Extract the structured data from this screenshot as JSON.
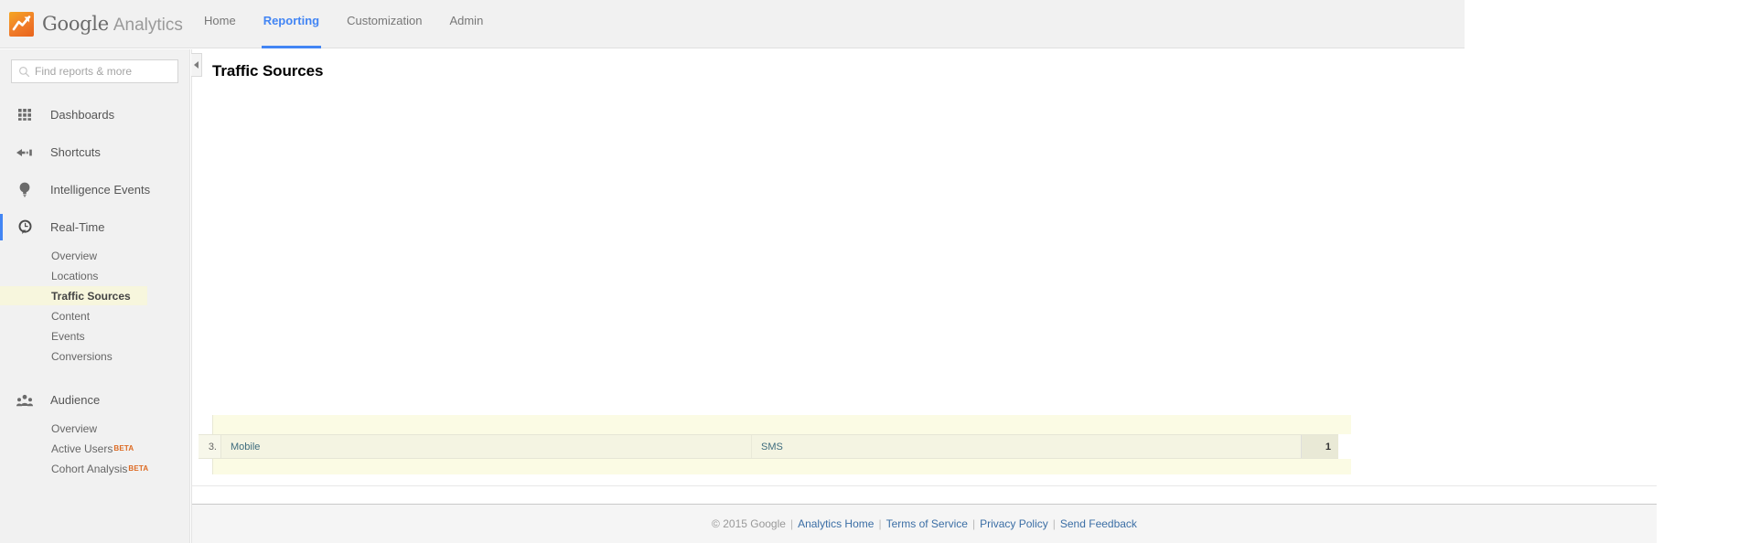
{
  "brand": {
    "logo_icon": "google-analytics-logo-icon",
    "google": "Google",
    "analytics": "Analytics",
    "accent_orange": "#ee6e2a"
  },
  "topnav": {
    "tabs": [
      {
        "label": "Home",
        "active": false
      },
      {
        "label": "Reporting",
        "active": true
      },
      {
        "label": "Customization",
        "active": false
      },
      {
        "label": "Admin",
        "active": false
      }
    ],
    "active_color": "#4285f4"
  },
  "sidebar": {
    "search": {
      "placeholder": "Find reports & more",
      "value": "",
      "icon": "search-icon"
    },
    "groups": [
      {
        "label": "Dashboards",
        "icon": "dashboards-grid-icon",
        "selected": false,
        "subitems": []
      },
      {
        "label": "Shortcuts",
        "icon": "shortcuts-arrow-icon",
        "selected": false,
        "subitems": []
      },
      {
        "label": "Intelligence Events",
        "icon": "lightbulb-icon",
        "selected": false,
        "subitems": []
      },
      {
        "label": "Real-Time",
        "icon": "realtime-clock-icon",
        "selected": true,
        "subitems": [
          {
            "label": "Overview",
            "active": false,
            "badge": ""
          },
          {
            "label": "Locations",
            "active": false,
            "badge": ""
          },
          {
            "label": "Traffic Sources",
            "active": true,
            "badge": ""
          },
          {
            "label": "Content",
            "active": false,
            "badge": ""
          },
          {
            "label": "Events",
            "active": false,
            "badge": ""
          },
          {
            "label": "Conversions",
            "active": false,
            "badge": ""
          }
        ]
      },
      {
        "label": "Audience",
        "icon": "audience-people-icon",
        "selected": false,
        "subitems": [
          {
            "label": "Overview",
            "active": false,
            "badge": ""
          },
          {
            "label": "Active Users",
            "active": false,
            "badge": "BETA"
          },
          {
            "label": "Cohort Analysis",
            "active": false,
            "badge": "BETA"
          }
        ]
      }
    ],
    "collapse_icon": "collapse-left-arrow-icon",
    "active_highlight_color": "#f7f6dd",
    "beta_color": "#dd6a22"
  },
  "main": {
    "title": "Traffic Sources"
  },
  "table": {
    "rows": [
      {
        "index": "3.",
        "dimension": "Mobile",
        "dimension2": "SMS",
        "value": "1"
      }
    ]
  },
  "footer": {
    "copyright": "© 2015 Google",
    "links": [
      "Analytics Home",
      "Terms of Service",
      "Privacy Policy",
      "Send Feedback"
    ],
    "separator": "|",
    "link_color": "#3b6ea5"
  }
}
